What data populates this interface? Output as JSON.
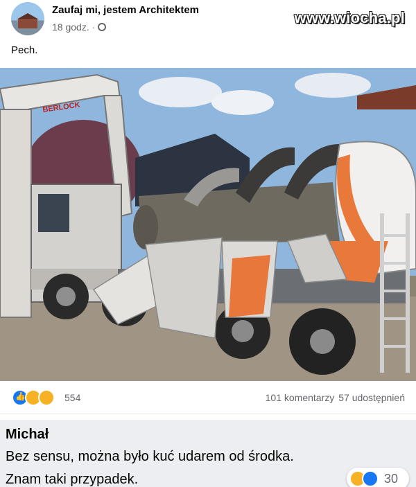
{
  "post": {
    "page_name": "Zaufaj mi, jestem Architektem",
    "time": "18 godz. ·",
    "caption": "Pech.",
    "watermark": "www.wiocha.pl"
  },
  "photo": {
    "truck_brand": "BERLOCK"
  },
  "reactions": {
    "count": "554",
    "comments": "101 komentarzy",
    "shares": "57 udostępnień",
    "types": [
      "like-icon",
      "haha-icon",
      "wow-icon"
    ]
  },
  "comment": {
    "author": "Michał",
    "line1": "Bez sensu, można było kuć udarem od środka.",
    "line2": "Znam taki przypadek.",
    "reaction_count": "30"
  },
  "colors": {
    "like_blue": "#1877f2",
    "haha_yellow": "#f7b125",
    "meta_gray": "#65676b",
    "bubble_bg": "#eceef1"
  }
}
